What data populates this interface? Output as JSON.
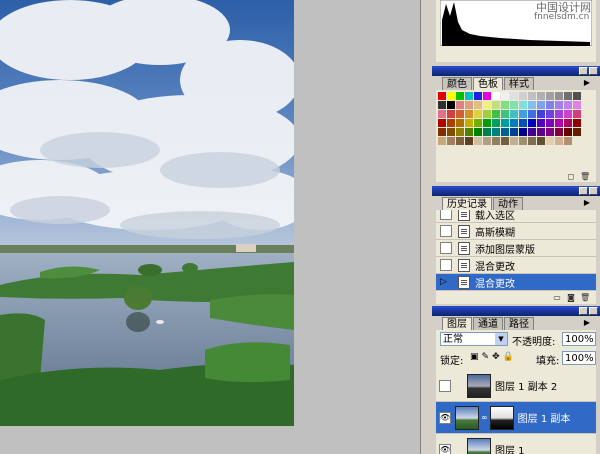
{
  "watermark": {
    "line1": "中国设计网",
    "line2": "fnnelsdm.cn"
  },
  "swatches_panel": {
    "tabs": [
      "颜色",
      "色板",
      "样式"
    ],
    "active_tab": 1,
    "colors": [
      "#e00000",
      "#ffff00",
      "#00c000",
      "#00c0c0",
      "#2020e0",
      "#e000e0",
      "#ffffff",
      "#f0f0f0",
      "#e0e0e0",
      "#d0d0d0",
      "#c0c0c0",
      "#b0b0b0",
      "#a0a0a0",
      "#909090",
      "#707070",
      "#505050",
      "#303030",
      "#000000",
      "#e08080",
      "#e0a080",
      "#e0c080",
      "#f0f080",
      "#c0e080",
      "#80e080",
      "#80e0b0",
      "#80e0e0",
      "#80c0f0",
      "#80a0f0",
      "#8080f0",
      "#a080f0",
      "#c080f0",
      "#e080e0",
      "#e07090",
      "#d04040",
      "#d06030",
      "#d09030",
      "#e0d040",
      "#a0d040",
      "#40c040",
      "#40c080",
      "#40c0c0",
      "#40a0e0",
      "#4070e0",
      "#4040e0",
      "#7040e0",
      "#a040e0",
      "#d040d0",
      "#d04080",
      "#b00000",
      "#b04000",
      "#b07000",
      "#c0b000",
      "#70b000",
      "#00a000",
      "#00a060",
      "#00a0a0",
      "#0080c0",
      "#0050c0",
      "#0000c0",
      "#5000c0",
      "#8000c0",
      "#b000b0",
      "#b00060",
      "#900000",
      "#803000",
      "#805000",
      "#908000",
      "#508000",
      "#008000",
      "#008050",
      "#008080",
      "#006090",
      "#004090",
      "#000090",
      "#400090",
      "#600090",
      "#800080",
      "#800040",
      "#600000",
      "#602000",
      "#c8a878",
      "#a08060",
      "#806040",
      "#604020",
      "#d0c0a0",
      "#b0a080",
      "#908060",
      "#706040",
      "#c0b090",
      "#a09070",
      "#807050",
      "#605030",
      "#e0d0b0",
      "#d0b090",
      "#b09070",
      "#ece9d8"
    ]
  },
  "history_panel": {
    "tabs": [
      "历史记录",
      "动作"
    ],
    "active_tab": 0,
    "items": [
      "载入选区",
      "高斯模糊",
      "添加图层蒙版",
      "混合更改",
      "混合更改"
    ],
    "selected_index": 4
  },
  "layers_panel": {
    "tabs": [
      "图层",
      "通道",
      "路径"
    ],
    "active_tab": 0,
    "blend_mode": "正常",
    "opacity_label": "不透明度:",
    "opacity_value": "100%",
    "lock_label": "锁定:",
    "fill_label": "填充:",
    "fill_value": "100%",
    "layers": [
      {
        "name": "图层 1 副本 2",
        "visible": false,
        "selected": false
      },
      {
        "name": "图层 1 副本",
        "visible": true,
        "selected": true
      },
      {
        "name": "图层 1",
        "visible": true,
        "selected": false
      }
    ]
  },
  "colors": {
    "title_bar": "#0a246a",
    "selection": "#3169c6",
    "panel_bg": "#ece9d8",
    "workspace": "#c0c0c0"
  }
}
